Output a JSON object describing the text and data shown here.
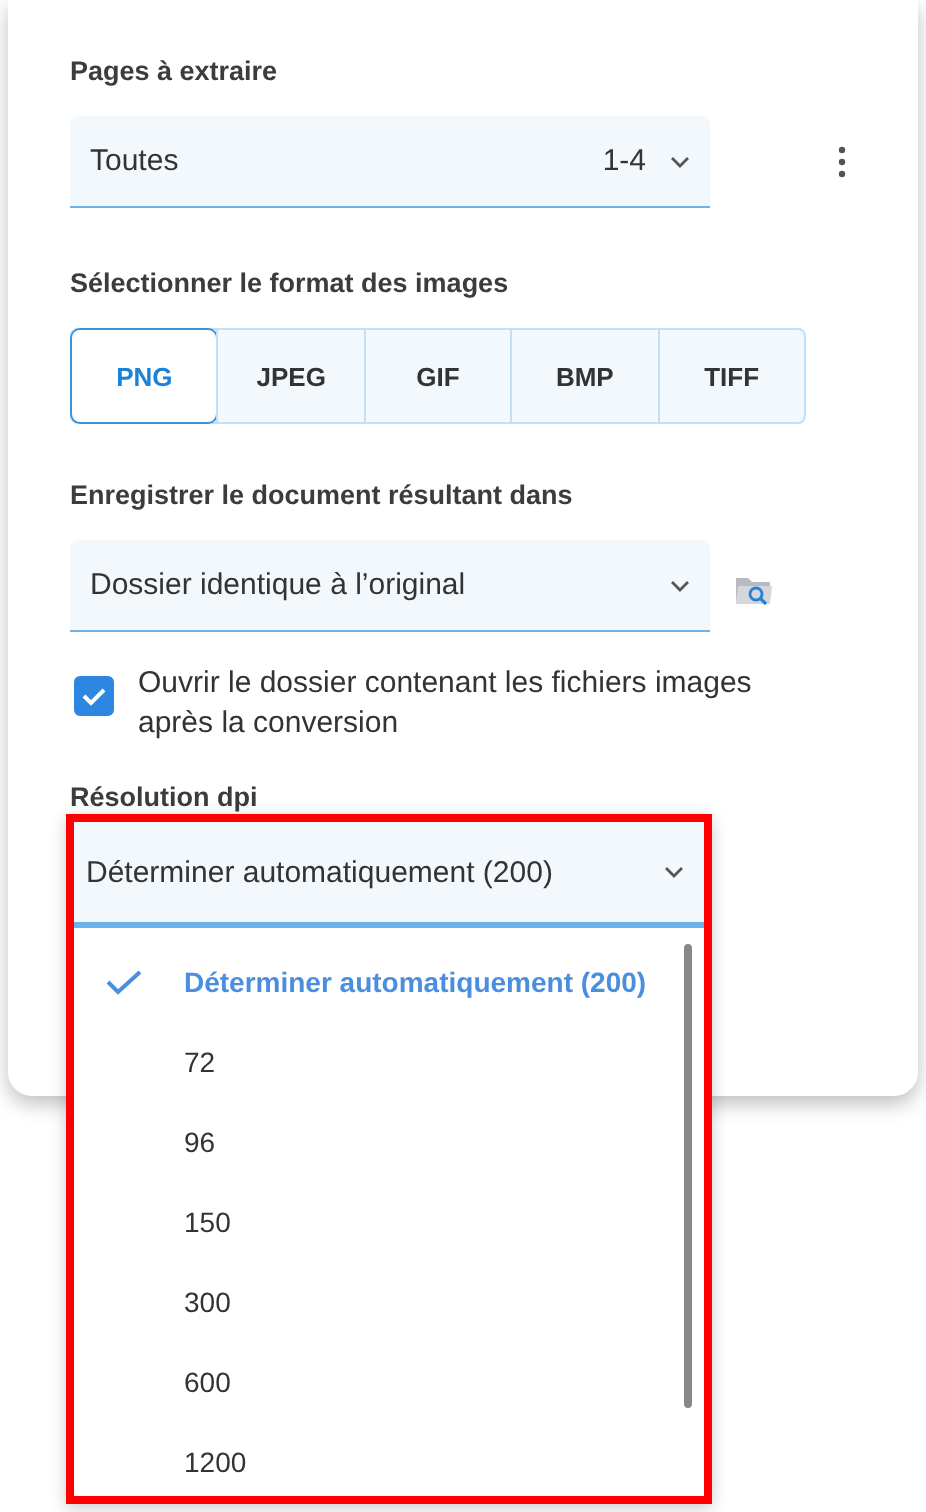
{
  "pages": {
    "label": "Pages à extraire",
    "value": "Toutes",
    "range": "1-4"
  },
  "format": {
    "label": "Sélectionner le format des images",
    "options": [
      {
        "label": "PNG",
        "selected": true
      },
      {
        "label": "JPEG",
        "selected": false
      },
      {
        "label": "GIF",
        "selected": false
      },
      {
        "label": "BMP",
        "selected": false
      },
      {
        "label": "TIFF",
        "selected": false
      }
    ]
  },
  "destination": {
    "label": "Enregistrer le document résultant dans",
    "value": "Dossier identique à l’original"
  },
  "open_folder": {
    "label": "Ouvrir le dossier contenant les fichiers images après la conversion",
    "checked": true
  },
  "resolution": {
    "label": "Résolution dpi",
    "value": "Déterminer automatiquement (200)",
    "expanded": true,
    "highlighted": true,
    "options": [
      {
        "label": "Déterminer automatiquement (200)",
        "selected": true
      },
      {
        "label": "72",
        "selected": false
      },
      {
        "label": "96",
        "selected": false
      },
      {
        "label": "150",
        "selected": false
      },
      {
        "label": "300",
        "selected": false
      },
      {
        "label": "600",
        "selected": false
      },
      {
        "label": "1200",
        "selected": false
      }
    ]
  }
}
